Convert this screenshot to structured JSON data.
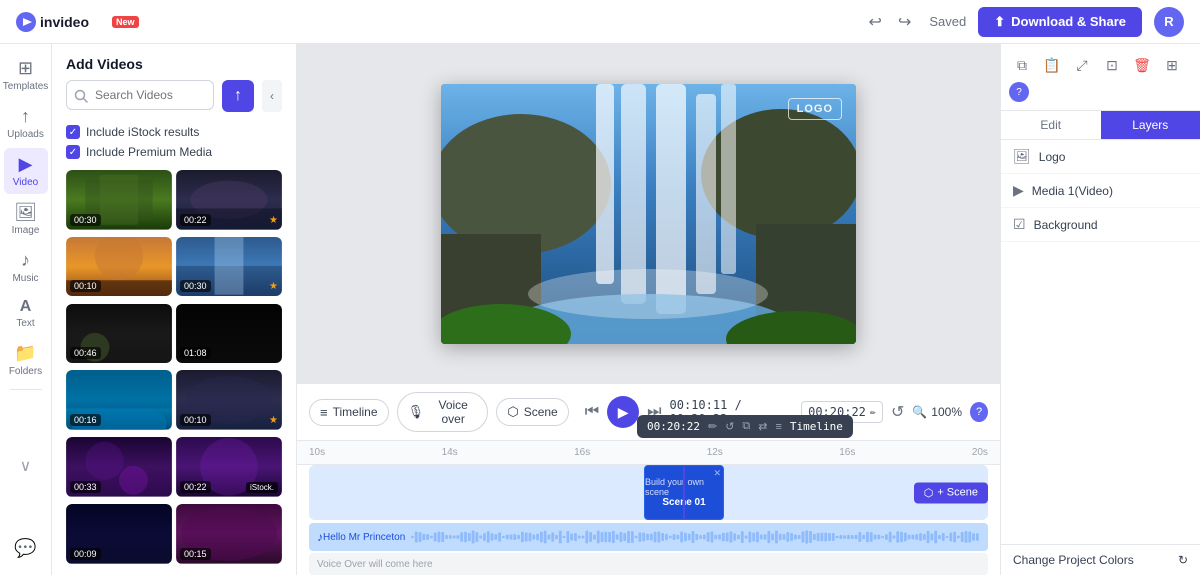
{
  "app": {
    "name": "invideo",
    "badge": "New"
  },
  "topbar": {
    "saved_label": "Saved",
    "download_label": "Download & Share",
    "user_initial": "R"
  },
  "sidebar": {
    "items": [
      {
        "id": "templates",
        "icon": "⊞",
        "label": "Templates"
      },
      {
        "id": "uploads",
        "icon": "↑",
        "label": "Uploads"
      },
      {
        "id": "video",
        "icon": "▶",
        "label": "Video",
        "active": true
      },
      {
        "id": "image",
        "icon": "🖼",
        "label": "Image"
      },
      {
        "id": "music",
        "icon": "♪",
        "label": "Music"
      },
      {
        "id": "text",
        "icon": "A",
        "label": "Text"
      },
      {
        "id": "folders",
        "icon": "📁",
        "label": "Folders"
      }
    ]
  },
  "panel": {
    "title": "Add Videos",
    "search_placeholder": "Search Videos",
    "include_istock": "Include iStock results",
    "include_premium": "Include Premium Media",
    "videos": [
      {
        "time": "00:30",
        "starred": false,
        "color1": "#2d5016",
        "color2": "#1a3a0a"
      },
      {
        "time": "00:22",
        "starred": true,
        "color1": "#1a1a2e",
        "color2": "#16213e"
      },
      {
        "time": "00:10",
        "starred": false,
        "color1": "#c77836",
        "color2": "#8b4513"
      },
      {
        "time": "00:30",
        "starred": true,
        "color1": "#2d5a8e",
        "color2": "#1a3a6c"
      },
      {
        "time": "00:46",
        "starred": false,
        "color1": "#1a1a1a",
        "color2": "#2a2a2a"
      },
      {
        "time": "01:08",
        "starred": false,
        "color1": "#0d0d0d",
        "color2": "#1a1a1a"
      },
      {
        "time": "00:16",
        "starred": false,
        "color1": "#006994",
        "color2": "#004f7c"
      },
      {
        "time": "00:10",
        "starred": true,
        "color1": "#1a1a2e",
        "color2": "#16213e"
      },
      {
        "time": "00:33",
        "starred": false,
        "color1": "#1a0533",
        "color2": "#2d0a4e"
      },
      {
        "time": "00:22",
        "starred": false,
        "color1": "#2d0a4e",
        "color2": "#1a0533",
        "istock": true
      },
      {
        "time": "00:09",
        "starred": false,
        "color1": "#0a0a2e",
        "color2": "#16163d"
      },
      {
        "time": "00:15",
        "starred": false,
        "color1": "#3d0a3d",
        "color2": "#2a0a2a"
      }
    ]
  },
  "canvas": {
    "logo_watermark": "LOGO"
  },
  "timeline": {
    "btn_timeline": "Timeline",
    "btn_voiceover": "Voice over",
    "btn_scene": "Scene",
    "time_current": "00:10:11",
    "time_total": "00:20:22",
    "time_input": "00:20:22",
    "zoom_label": "100%",
    "ruler_marks": [
      "10s",
      "14s",
      "16s",
      "12s",
      "16s",
      "20s"
    ],
    "scene_popup_time": "00:20:22",
    "scene_popup_timeline": "Timeline",
    "scene_label": "Scene 01",
    "scene_sublabel": "Build your own scene",
    "audio_label": "Hello Mr Princeton",
    "voiceover_placeholder": "Voice Over will come here",
    "scene_btn": "+ Scene"
  },
  "right_panel": {
    "tab_edit": "Edit",
    "tab_layers": "Layers",
    "layers": [
      {
        "id": "logo",
        "name": "Logo",
        "icon": "🖼"
      },
      {
        "id": "media1",
        "name": "Media 1(Video)",
        "icon": "▶"
      },
      {
        "id": "background",
        "name": "Background",
        "icon": "☑"
      }
    ],
    "change_colors": "Change Project Colors"
  }
}
